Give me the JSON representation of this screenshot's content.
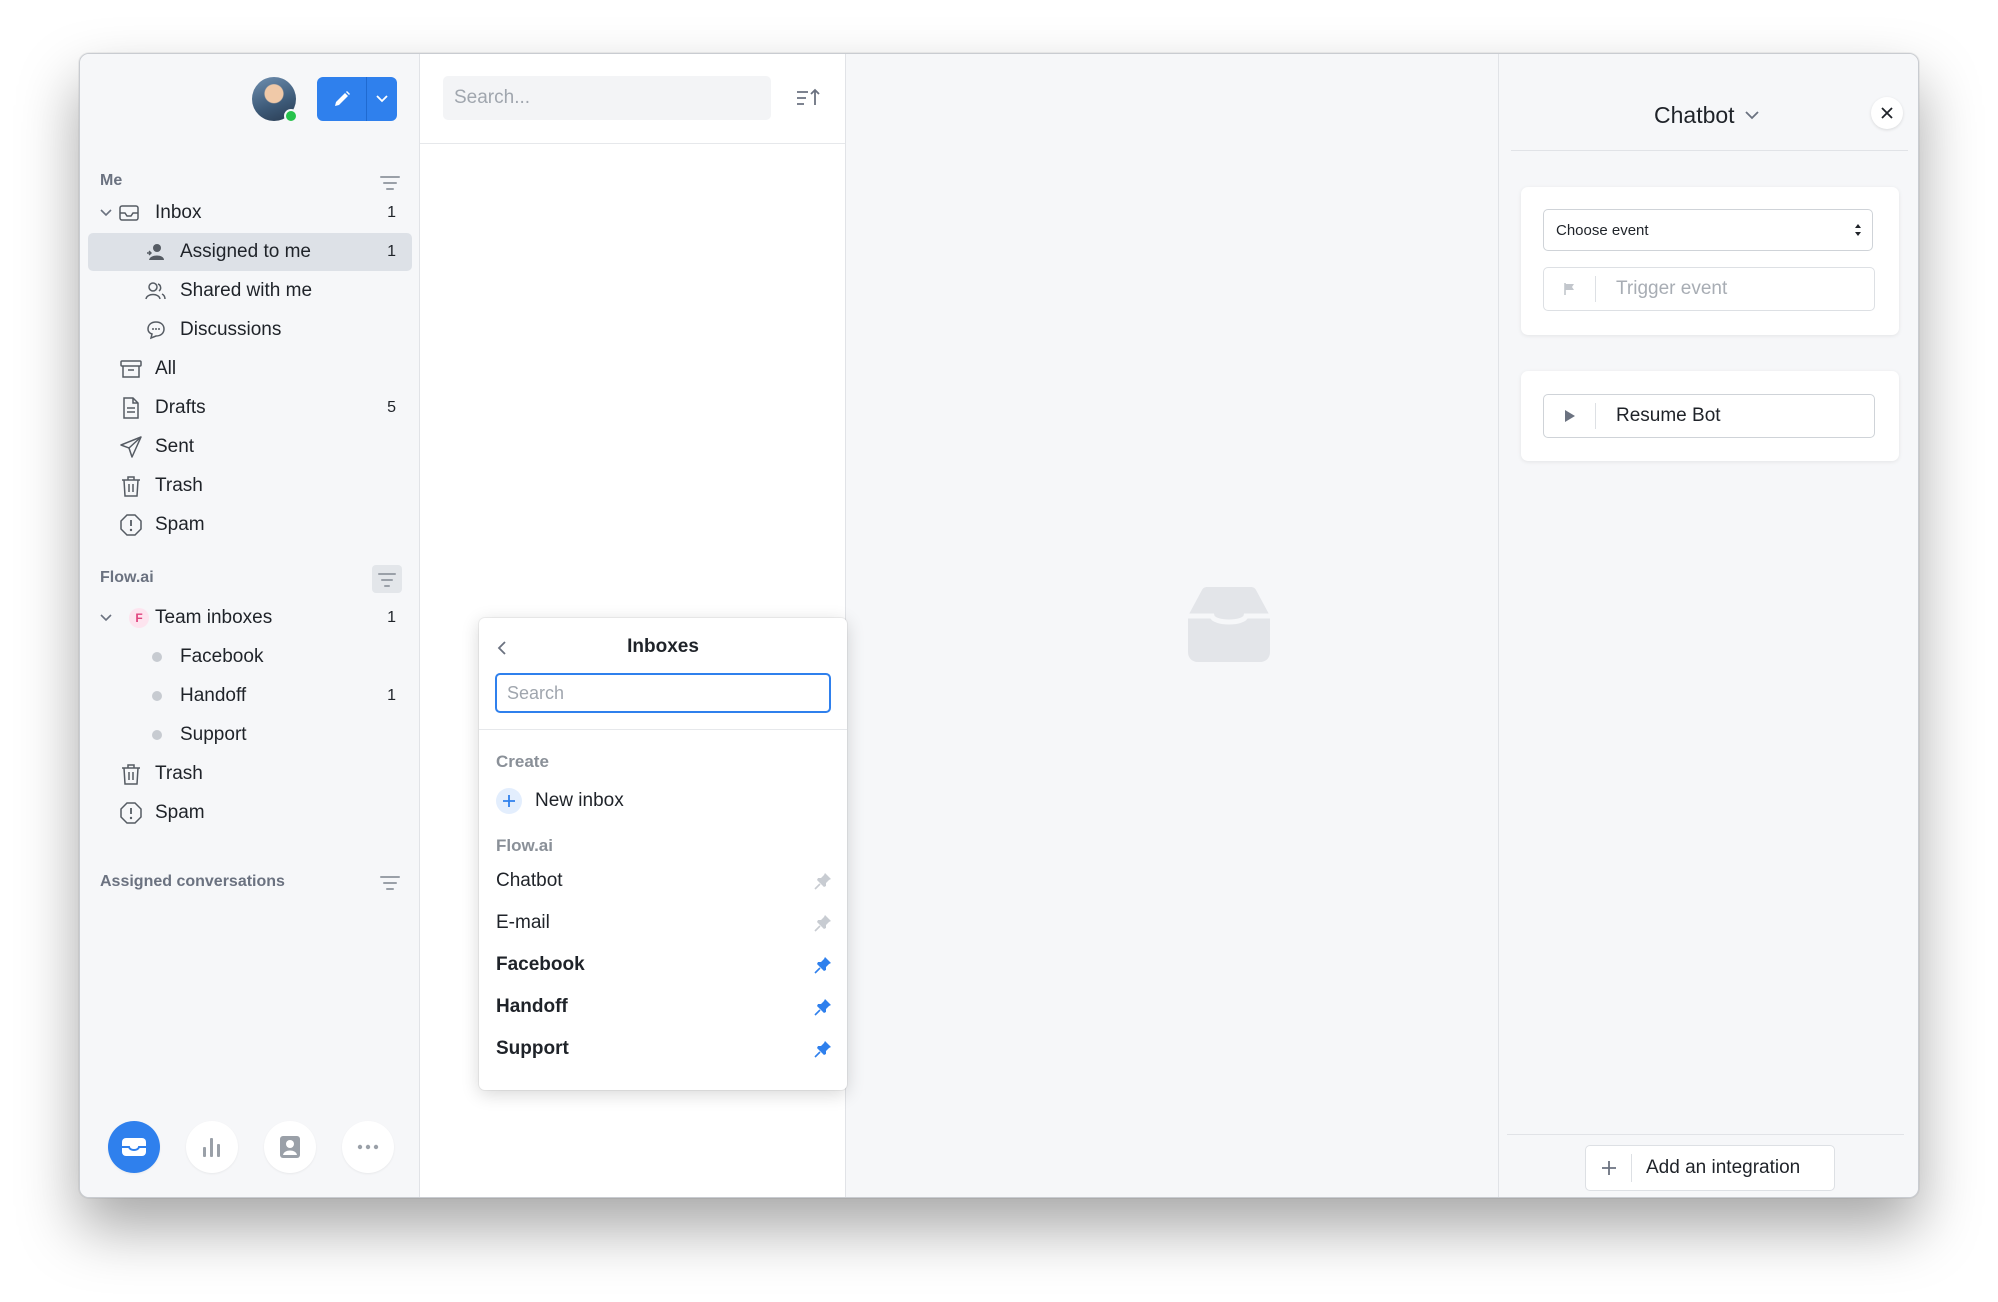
{
  "sidebar": {
    "me_title": "Me",
    "me_items": [
      {
        "label": "Inbox",
        "count": "1"
      },
      {
        "label": "Assigned to me",
        "count": "1"
      },
      {
        "label": "Shared with me",
        "count": ""
      },
      {
        "label": "Discussions",
        "count": ""
      },
      {
        "label": "All",
        "count": ""
      },
      {
        "label": "Drafts",
        "count": "5"
      },
      {
        "label": "Sent",
        "count": ""
      },
      {
        "label": "Trash",
        "count": ""
      },
      {
        "label": "Spam",
        "count": ""
      }
    ],
    "team_title": "Flow.ai",
    "team_badge": "F",
    "team_items": [
      {
        "label": "Team inboxes",
        "count": "1"
      },
      {
        "label": "Facebook",
        "count": ""
      },
      {
        "label": "Handoff",
        "count": "1"
      },
      {
        "label": "Support",
        "count": ""
      },
      {
        "label": "Trash",
        "count": ""
      },
      {
        "label": "Spam",
        "count": ""
      }
    ],
    "assigned_title": "Assigned conversations"
  },
  "list": {
    "search_placeholder": "Search..."
  },
  "popover": {
    "title": "Inboxes",
    "search_placeholder": "Search",
    "create_section": "Create",
    "new_inbox_label": "New inbox",
    "flow_section": "Flow.ai",
    "inboxes": [
      {
        "label": "Chatbot",
        "pinned": false
      },
      {
        "label": "E-mail",
        "pinned": false
      },
      {
        "label": "Facebook",
        "pinned": true
      },
      {
        "label": "Handoff",
        "pinned": true
      },
      {
        "label": "Support",
        "pinned": true
      }
    ]
  },
  "right_panel": {
    "title": "Chatbot",
    "select_value": "Choose event",
    "trigger_label": "Trigger event",
    "resume_label": "Resume Bot",
    "add_integration_label": "Add an integration"
  },
  "colors": {
    "accent": "#2f80ed",
    "online": "#27c24c",
    "active_row": "#dde1e7"
  }
}
